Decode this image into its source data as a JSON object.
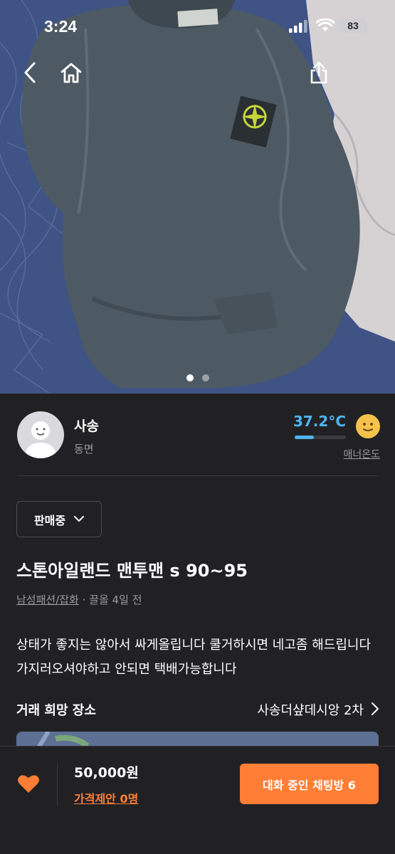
{
  "status_bar": {
    "time": "3:24",
    "battery": "83"
  },
  "carousel": {
    "count": 2,
    "active": 0
  },
  "seller": {
    "name": "사송",
    "location": "동면",
    "temperature": "37.2°C",
    "temperature_level": 0.372,
    "manner_label": "매너온도"
  },
  "product": {
    "status": "판매중",
    "title": "스톤아일랜드 맨투맨 s 90~95",
    "category": "남성패션/잡화",
    "bump_time": " · 끌올 4일 전",
    "description": "상태가 좋지는 않아서 싸게올립니다 쿨거하시면 네고좀 해드립니다 가지러오셔야하고 안되면 택배가능합니다"
  },
  "meeting_place": {
    "label": "거래 희망 장소",
    "value": "사송더샾데시앙 2차"
  },
  "bottom": {
    "price": "50,000원",
    "offer": "가격제안 0명",
    "chat_button": "대화 중인 채팅방 6"
  },
  "colors": {
    "accent": "#ff7e36",
    "temperature": "#4fb5f0",
    "background": "#212124"
  }
}
